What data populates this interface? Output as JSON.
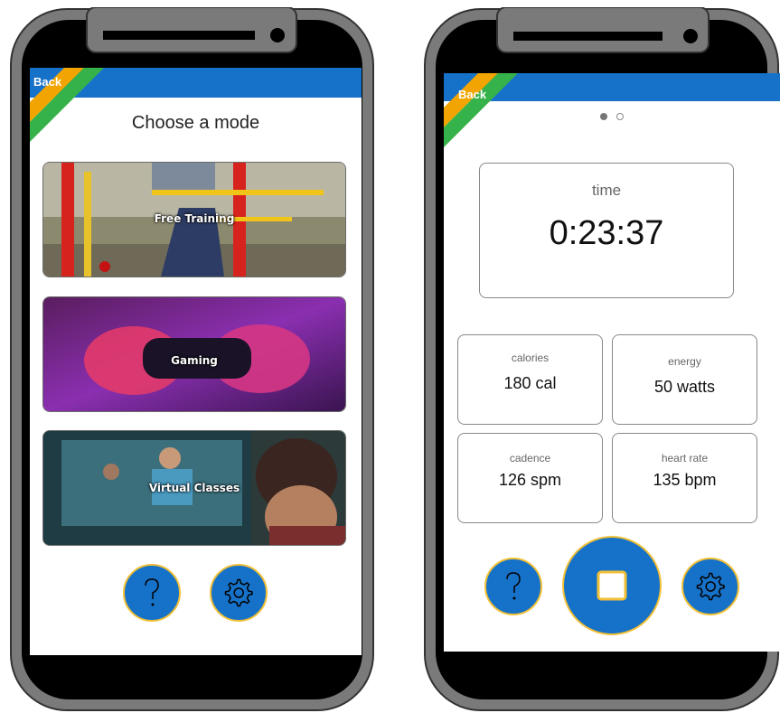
{
  "colors": {
    "accent": "#1672c8",
    "ring": "#f2c037",
    "stripe_yellow": "#f2a500",
    "stripe_green": "#36b24a",
    "phone_body": "#000000",
    "phone_bezel": "#7a7a7a"
  },
  "screen1": {
    "back_label": "Back",
    "title": "Choose a mode",
    "modes": [
      {
        "label": "Free Training"
      },
      {
        "label": "Gaming"
      },
      {
        "label": "Virtual Classes"
      }
    ],
    "help_icon": "question-mark-icon",
    "settings_icon": "gear-icon"
  },
  "screen2": {
    "back_label": "Back",
    "pager": {
      "pages": 2,
      "current": 1
    },
    "time": {
      "label": "time",
      "value": "0:23:37"
    },
    "stats": [
      {
        "label": "calories",
        "value": "180 cal"
      },
      {
        "label": "energy",
        "value": "50 watts"
      },
      {
        "label": "cadence",
        "value": "126 spm"
      },
      {
        "label": "heart rate",
        "value": "135 bpm"
      }
    ],
    "help_icon": "question-mark-icon",
    "stop_icon": "stop-square-icon",
    "settings_icon": "gear-icon"
  }
}
